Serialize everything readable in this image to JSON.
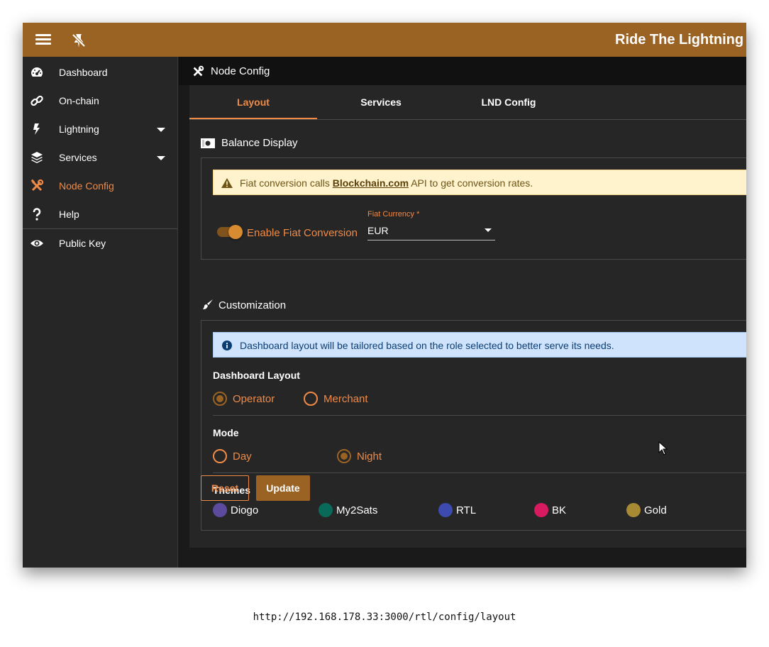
{
  "topbar": {
    "app_title": "Ride The Lightning - (",
    "menu_icon": "hamburger-menu-icon",
    "pin_icon": "unpin-icon"
  },
  "sidebar": {
    "items": [
      {
        "label": "Dashboard",
        "icon": "dashboard-gauge-icon"
      },
      {
        "label": "On-chain",
        "icon": "chain-link-icon"
      },
      {
        "label": "Lightning",
        "icon": "lightning-bolt-icon"
      },
      {
        "label": "Services",
        "icon": "layers-icon"
      },
      {
        "label": "Node Config",
        "icon": "tools-icon"
      },
      {
        "label": "Help",
        "icon": "question-icon"
      },
      {
        "label": "Public Key",
        "icon": "eye-icon"
      }
    ]
  },
  "page": {
    "title": "Node Config"
  },
  "tabs": [
    {
      "label": "Layout"
    },
    {
      "label": "Services"
    },
    {
      "label": "LND Config"
    }
  ],
  "balance": {
    "title": "Balance Display",
    "alert_prefix": "Fiat conversion calls ",
    "alert_link": "Blockchain.com",
    "alert_suffix": " API to get conversion rates.",
    "toggle_label": "Enable Fiat Conversion",
    "currency_label": "Fiat Currency *",
    "currency_value": "EUR"
  },
  "customization": {
    "title": "Customization",
    "info": "Dashboard layout will be tailored based on the role selected to better serve its needs.",
    "dashboard_layout_label": "Dashboard Layout",
    "layout_options": [
      "Operator",
      "Merchant"
    ],
    "mode_label": "Mode",
    "mode_options": [
      "Day",
      "Night"
    ],
    "themes_label": "Themes",
    "themes": [
      {
        "name": "Diogo",
        "color": "#5b4a9e"
      },
      {
        "name": "My2Sats",
        "color": "#0a6a5a"
      },
      {
        "name": "RTL",
        "color": "#3d4ab0"
      },
      {
        "name": "BK",
        "color": "#d81b60"
      },
      {
        "name": "Gold",
        "color": "#a88a35"
      }
    ]
  },
  "buttons": {
    "reset": "Reset",
    "update": "Update"
  },
  "url": "http://192.168.178.33:3000/rtl/config/layout",
  "colors": {
    "accent": "#f08a47",
    "primary": "#9a6323",
    "background": "#1a1a1a",
    "card": "#262626"
  }
}
